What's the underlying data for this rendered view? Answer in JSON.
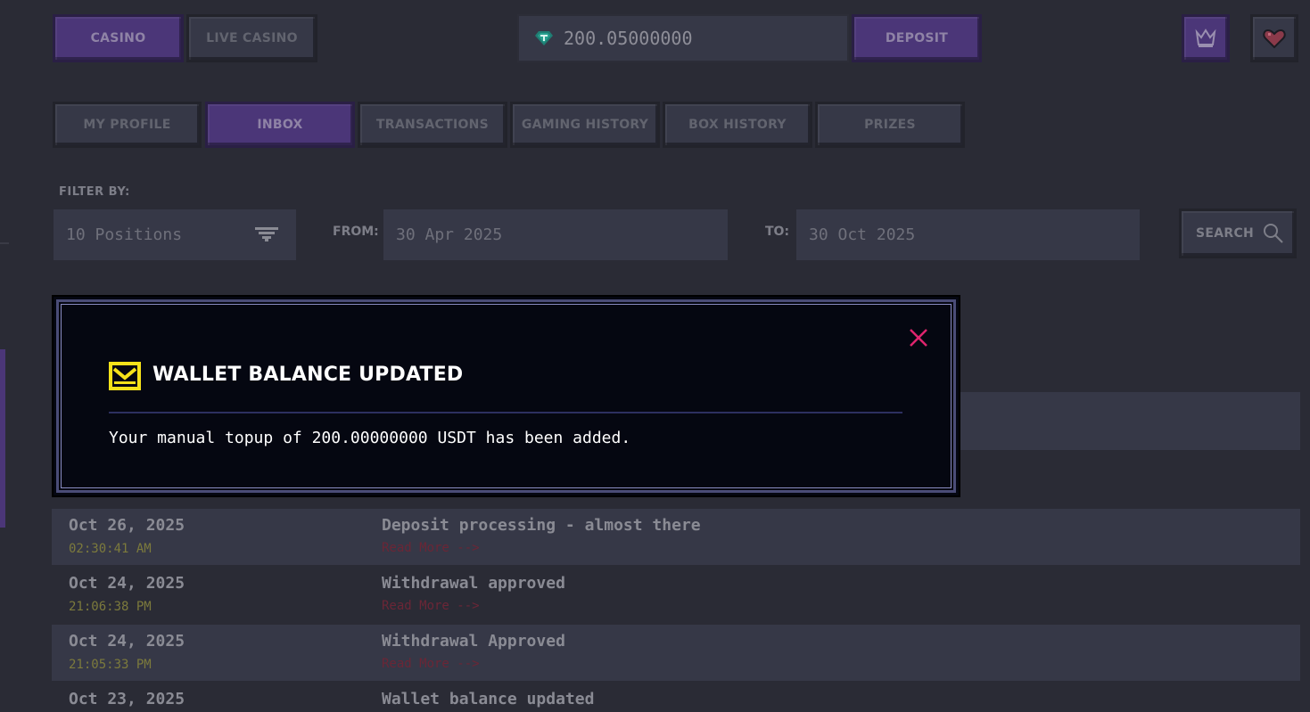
{
  "nav": {
    "casino": "CASINO",
    "live_casino": "LIVE CASINO",
    "deposit": "DEPOSIT"
  },
  "wallet": {
    "balance": "200.05000000",
    "currency_icon": "tether-gem-icon",
    "accent": "#4b3678"
  },
  "tabs": [
    {
      "label": "MY PROFILE",
      "active": false
    },
    {
      "label": "INBOX",
      "active": true
    },
    {
      "label": "TRANSACTIONS",
      "active": false
    },
    {
      "label": "GAMING HISTORY",
      "active": false
    },
    {
      "label": "BOX HISTORY",
      "active": false
    },
    {
      "label": "PRIZES",
      "active": false
    }
  ],
  "filter": {
    "label": "FILTER BY:",
    "positions": "10 Positions",
    "from_label": "FROM:",
    "from_value": "30 Apr 2025",
    "to_label": "TO:",
    "to_value": "30 Oct 2025",
    "search_label": "SEARCH"
  },
  "messages": [
    {
      "date": "Oct 26, 2025",
      "time": "02:30:41 AM",
      "title": "Deposit processing - almost there",
      "more": "Read More -->"
    },
    {
      "date": "Oct 24, 2025",
      "time": "21:06:38 PM",
      "title": "Withdrawal approved",
      "more": "Read More -->"
    },
    {
      "date": "Oct 24, 2025",
      "time": "21:05:33 PM",
      "title": "Withdrawal Approved",
      "more": "Read More -->"
    },
    {
      "date": "Oct 23, 2025",
      "time": "",
      "title": "Wallet balance updated",
      "more": ""
    }
  ],
  "modal": {
    "title": "WALLET BALANCE UPDATED",
    "body": "Your manual topup of 200.00000000 USDT has been added.",
    "close_color": "#e0246e",
    "icon_color": "#f5e21a"
  }
}
